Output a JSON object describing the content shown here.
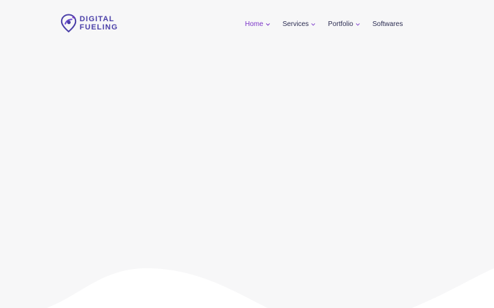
{
  "brand": {
    "name_line1": "DIGITAL",
    "name_line2": "FUELING",
    "color": "#4a3fa8"
  },
  "nav": {
    "items": [
      {
        "label": "Home",
        "active": true,
        "has_dropdown": true
      },
      {
        "label": "Services",
        "active": false,
        "has_dropdown": true
      },
      {
        "label": "Portfolio",
        "active": false,
        "has_dropdown": true
      },
      {
        "label": "Softwares",
        "active": false,
        "has_dropdown": false
      }
    ],
    "active_color": "#7b35c8",
    "text_color": "#2c2d52"
  },
  "colors": {
    "background": "#f7f7f8",
    "wave": "#ffffff"
  },
  "icons": [
    "logo-pin-icon",
    "chevron-down-icon"
  ]
}
